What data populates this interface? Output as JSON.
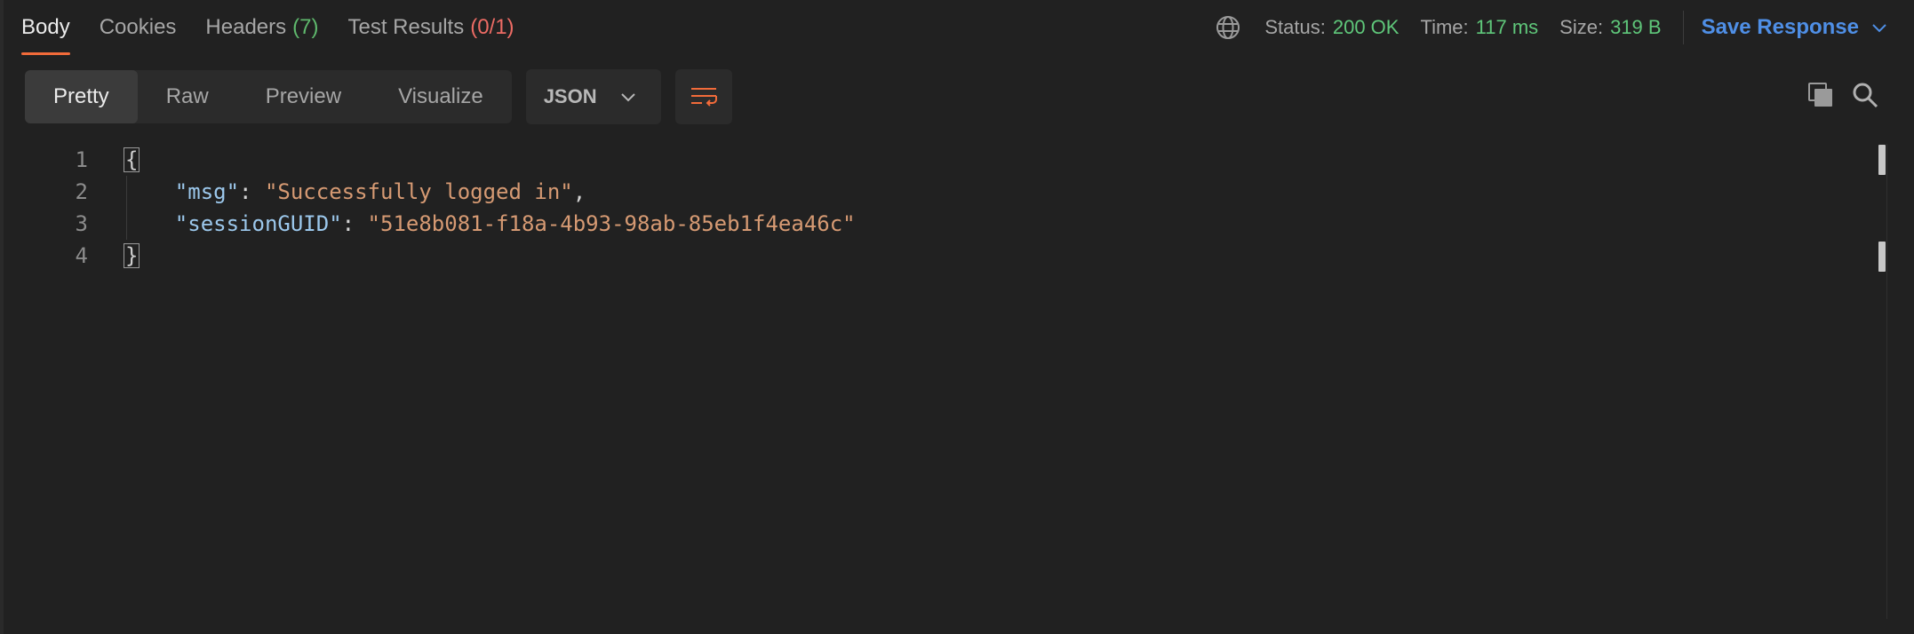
{
  "tabs": [
    {
      "label": "Body",
      "count": ""
    },
    {
      "label": "Cookies",
      "count": ""
    },
    {
      "label": "Headers",
      "count": "(7)"
    },
    {
      "label": "Test Results",
      "count": "(0/1)"
    }
  ],
  "status": {
    "status_label": "Status:",
    "status_value": "200 OK",
    "time_label": "Time:",
    "time_value": "117 ms",
    "size_label": "Size:",
    "size_value": "319 B",
    "save_label": "Save Response"
  },
  "view_modes": [
    "Pretty",
    "Raw",
    "Preview",
    "Visualize"
  ],
  "format": "JSON",
  "code": {
    "line_numbers": [
      "1",
      "2",
      "3",
      "4"
    ],
    "open_brace": "{",
    "close_brace": "}",
    "key1": "\"msg\"",
    "value1": "\"Successfully logged in\"",
    "key2": "\"sessionGUID\"",
    "value2": "\"51e8b081-f18a-4b93-98ab-85eb1f4ea46c\""
  },
  "colors": {
    "accent": "#f26b3a",
    "status_ok": "#5fc77a",
    "link": "#4f8fe6"
  },
  "icons": [
    "globe-icon",
    "chevron-down-icon",
    "wrap-lines-icon",
    "copy-icon",
    "search-icon"
  ]
}
